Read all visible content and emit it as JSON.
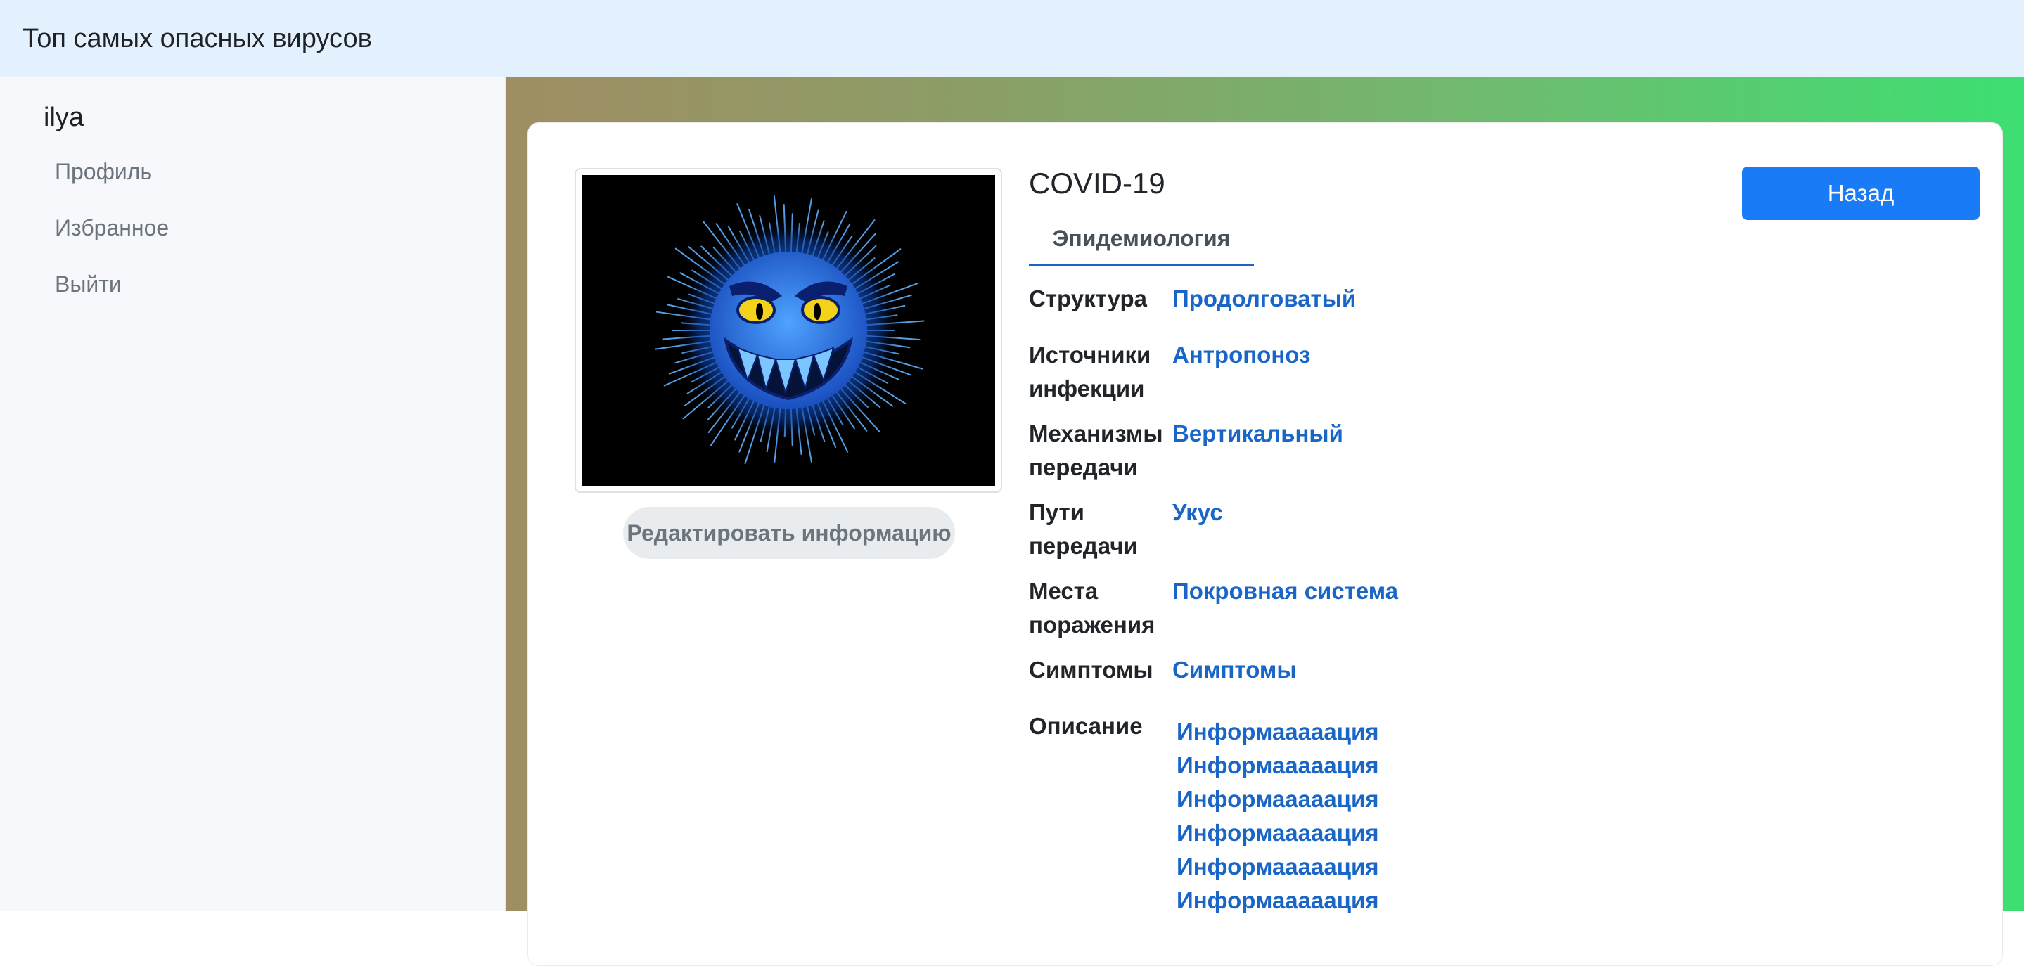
{
  "navbar": {
    "brand": "Топ самых опасных вирусов"
  },
  "sidebar": {
    "username": "ilya",
    "links": [
      {
        "label": "Профиль"
      },
      {
        "label": "Избранное"
      },
      {
        "label": "Выйти"
      }
    ]
  },
  "virus": {
    "title": "COVID-19",
    "back_label": "Назад",
    "edit_label": "Редактировать информацию",
    "tab_label": "Эпидемиология",
    "image_icon": "monster-virus-image",
    "fields": [
      {
        "label_line1": "Структура",
        "label_line2": "",
        "value": "Продолговатый"
      },
      {
        "label_line1": "Источники",
        "label_line2": "инфекции",
        "value": "Антропоноз"
      },
      {
        "label_line1": "Механизмы",
        "label_line2": "передачи",
        "value": "Вертикальный"
      },
      {
        "label_line1": "Пути",
        "label_line2": "передачи",
        "value": "Укус"
      },
      {
        "label_line1": "Места",
        "label_line2": "поражения",
        "value": "Покровная система"
      },
      {
        "label_line1": "Симптомы",
        "label_line2": "",
        "value": "Симптомы"
      }
    ],
    "description_label": "Описание",
    "description_lines": [
      "Информааааация",
      "Информааааация",
      "Информааааация",
      "Информааааация",
      "Информааааация",
      "Информааааация"
    ]
  },
  "colors": {
    "navbar_bg": "#e2f1fd",
    "accent": "#1a7bf6",
    "link": "#1a66c7",
    "gradient_start": "#9f8e63",
    "gradient_end": "#3ddf72"
  }
}
